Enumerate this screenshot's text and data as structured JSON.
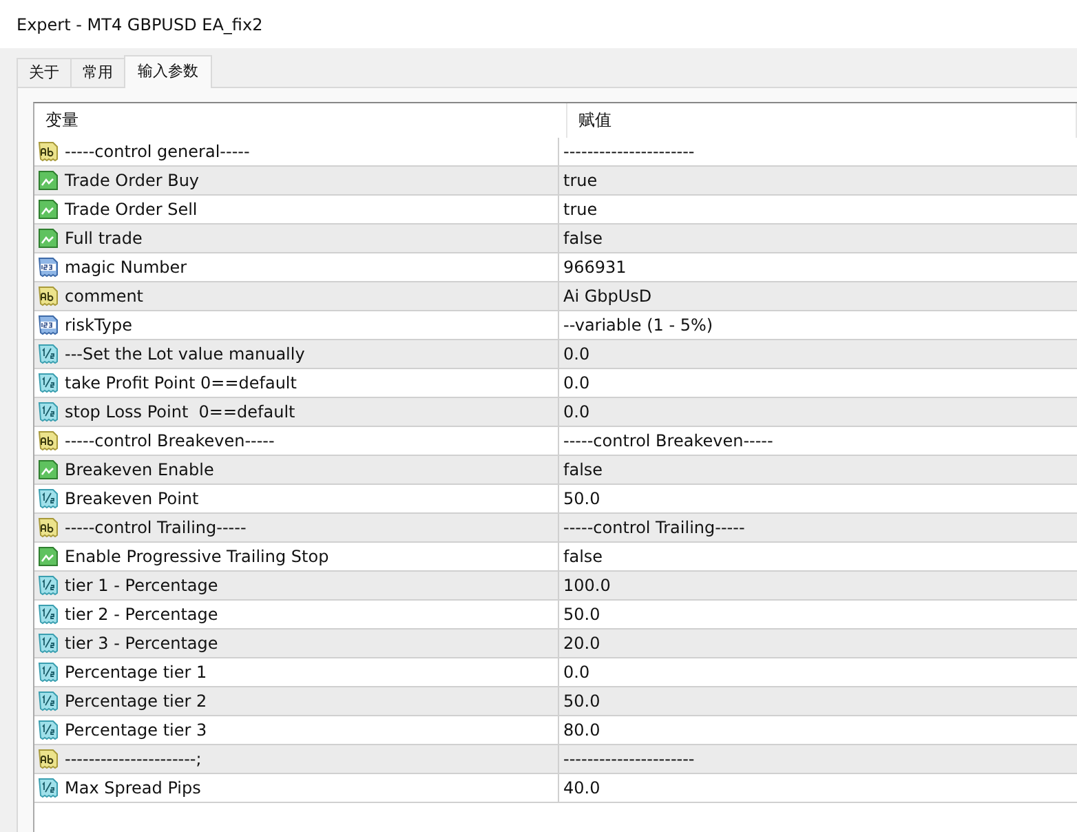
{
  "window": {
    "title": "Expert - MT4 GBPUSD EA_fix2"
  },
  "tabs": [
    {
      "label": "关于",
      "selected": false
    },
    {
      "label": "常用",
      "selected": false
    },
    {
      "label": "输入参数",
      "selected": true
    }
  ],
  "table": {
    "columns": [
      "变量",
      "赋值"
    ],
    "rows": [
      {
        "kind": "string",
        "name": "-----control general-----",
        "value": "----------------------"
      },
      {
        "kind": "bool",
        "name": "Trade Order Buy",
        "value": "true"
      },
      {
        "kind": "bool",
        "name": "Trade Order Sell",
        "value": "true"
      },
      {
        "kind": "bool",
        "name": "Full trade",
        "value": "false"
      },
      {
        "kind": "int",
        "name": "magic Number",
        "value": "966931"
      },
      {
        "kind": "string",
        "name": "comment",
        "value": "Ai GbpUsD"
      },
      {
        "kind": "int",
        "name": "riskType",
        "value": "--variable (1 - 5%)"
      },
      {
        "kind": "double",
        "name": "---Set the Lot value manually",
        "value": "0.0"
      },
      {
        "kind": "double",
        "name": "take Profit Point 0==default",
        "value": "0.0"
      },
      {
        "kind": "double",
        "name": "stop Loss Point  0==default",
        "value": "0.0"
      },
      {
        "kind": "string",
        "name": "-----control Breakeven-----",
        "value": "-----control Breakeven-----"
      },
      {
        "kind": "bool",
        "name": "Breakeven Enable",
        "value": "false"
      },
      {
        "kind": "double",
        "name": "Breakeven Point",
        "value": "50.0"
      },
      {
        "kind": "string",
        "name": "-----control Trailing-----",
        "value": "-----control Trailing-----"
      },
      {
        "kind": "bool",
        "name": "Enable Progressive Trailing Stop",
        "value": "false"
      },
      {
        "kind": "double",
        "name": "tier 1 - Percentage",
        "value": "100.0"
      },
      {
        "kind": "double",
        "name": "tier 2 - Percentage",
        "value": "50.0"
      },
      {
        "kind": "double",
        "name": "tier 3 - Percentage",
        "value": "20.0"
      },
      {
        "kind": "double",
        "name": "Percentage tier 1",
        "value": "0.0"
      },
      {
        "kind": "double",
        "name": "Percentage tier 2",
        "value": "50.0"
      },
      {
        "kind": "double",
        "name": "Percentage tier 3",
        "value": "80.0"
      },
      {
        "kind": "string",
        "name": "----------------------;",
        "value": "----------------------"
      },
      {
        "kind": "double",
        "name": "Max Spread Pips",
        "value": "40.0"
      }
    ]
  }
}
